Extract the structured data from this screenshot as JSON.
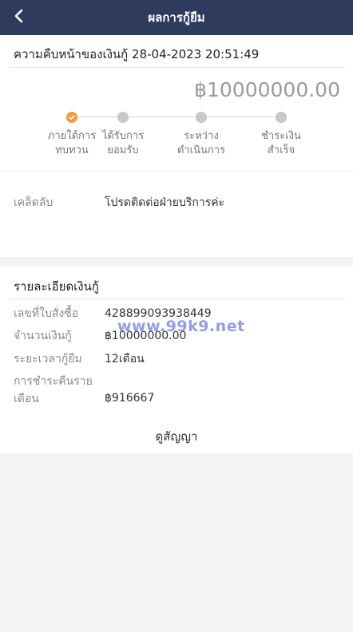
{
  "header": {
    "title": "ผลการกู้ยืม",
    "back_icon": "chevron-left-icon"
  },
  "progress": {
    "title": "ความคืบหน้าของเงินกู้ 28-04-2023 20:51:49",
    "amount": "฿10000000.00",
    "steps": [
      {
        "label": "ภายใต้การทบทวน",
        "active": true
      },
      {
        "label": "ได้รับการยอมรับ",
        "active": false
      },
      {
        "label": "ระหว่างดำเนินการ",
        "active": false
      },
      {
        "label": "ชำระเงินสำเร็จ",
        "active": false
      }
    ],
    "accent_color": "#f39b3a"
  },
  "tip": {
    "label": "เคล็ดลับ",
    "value": "โปรดติดต่อฝ่ายบริการค่ะ"
  },
  "details": {
    "title": "รายละเอียดเงินกู้",
    "rows": [
      {
        "label": "เลขที่ใบสั่งซื้อ",
        "value": "428899093938449"
      },
      {
        "label": "จำนวนเงินกู้",
        "value": "฿10000000.00"
      },
      {
        "label": "ระยะเวลากู้ยืม",
        "value": "12เดือน"
      },
      {
        "label": "การชำระคืนรายเดือน",
        "value": "฿916667"
      }
    ],
    "contract_link": "ดูสัญญา"
  },
  "watermark": "www.99k9.net",
  "colors": {
    "header_bg": "#2f3b5c",
    "page_bg": "#f3f3f6"
  }
}
